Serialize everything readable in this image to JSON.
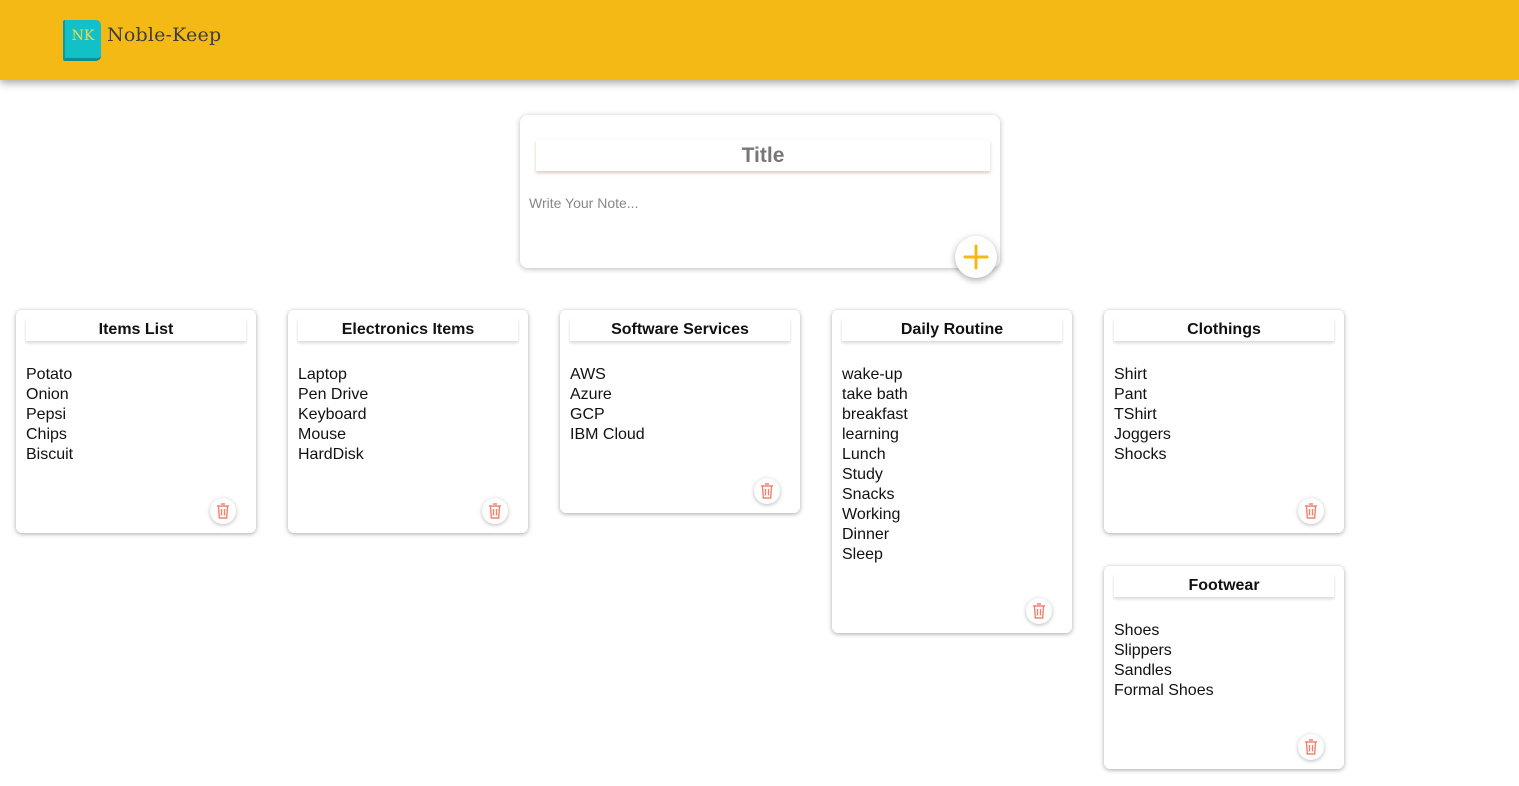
{
  "header": {
    "logo_text": "NK",
    "app_name": "Noble-Keep",
    "background": "#f5b916"
  },
  "create_note": {
    "title_placeholder": "Title",
    "body_placeholder": "Write Your Note...",
    "add_icon": "plus-icon",
    "accent": "#f5b916"
  },
  "notes": [
    {
      "title": "Items List",
      "items": [
        "Potato",
        "Onion",
        "Pepsi",
        "Chips",
        "Biscuit"
      ]
    },
    {
      "title": "Electronics Items",
      "items": [
        "Laptop",
        "Pen Drive",
        "Keyboard",
        "Mouse",
        "HardDisk"
      ]
    },
    {
      "title": "Software Services",
      "items": [
        "AWS",
        "Azure",
        "GCP",
        "IBM Cloud"
      ]
    },
    {
      "title": "Daily Routine",
      "items": [
        "wake-up",
        "take bath",
        "breakfast",
        "learning",
        "Lunch",
        "Study",
        "Snacks",
        "Working",
        "Dinner",
        "Sleep"
      ]
    },
    {
      "title": "Clothings",
      "items": [
        "Shirt",
        "Pant",
        "TShirt",
        "Joggers",
        "Shocks"
      ]
    },
    {
      "title": "Footwear",
      "items": [
        "Shoes",
        "Slippers",
        "Sandles",
        "Formal Shoes"
      ]
    }
  ],
  "delete_icon": "trash-icon",
  "delete_color": "#f08070"
}
